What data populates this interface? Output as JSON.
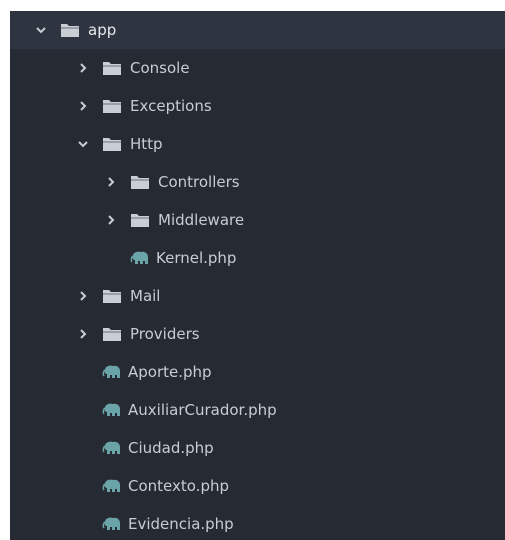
{
  "tree": {
    "items": [
      {
        "label": "app",
        "kind": "folder",
        "expanded": true,
        "depth": 0,
        "selected": true
      },
      {
        "label": "Console",
        "kind": "folder",
        "expanded": false,
        "depth": 1
      },
      {
        "label": "Exceptions",
        "kind": "folder",
        "expanded": false,
        "depth": 1
      },
      {
        "label": "Http",
        "kind": "folder",
        "expanded": true,
        "depth": 1
      },
      {
        "label": "Controllers",
        "kind": "folder",
        "expanded": false,
        "depth": 2
      },
      {
        "label": "Middleware",
        "kind": "folder",
        "expanded": false,
        "depth": 2
      },
      {
        "label": "Kernel.php",
        "kind": "php-file",
        "depth": 2
      },
      {
        "label": "Mail",
        "kind": "folder",
        "expanded": false,
        "depth": 1
      },
      {
        "label": "Providers",
        "kind": "folder",
        "expanded": false,
        "depth": 1
      },
      {
        "label": "Aporte.php",
        "kind": "php-file",
        "depth": 1
      },
      {
        "label": "AuxiliarCurador.php",
        "kind": "php-file",
        "depth": 1
      },
      {
        "label": "Ciudad.php",
        "kind": "php-file",
        "depth": 1
      },
      {
        "label": "Contexto.php",
        "kind": "php-file",
        "depth": 1
      },
      {
        "label": "Evidencia.php",
        "kind": "php-file",
        "depth": 1
      }
    ]
  },
  "colors": {
    "panel_bg": "#262a32",
    "selected_bg": "#2f3540",
    "text": "#c8ccd3",
    "folder_icon": "#c9cdd4",
    "php_icon": "#6aa3a8"
  },
  "icons": {
    "expanded": "chevron-down-icon",
    "collapsed": "chevron-right-icon",
    "folder": "folder-icon",
    "php": "php-elephant-icon"
  }
}
